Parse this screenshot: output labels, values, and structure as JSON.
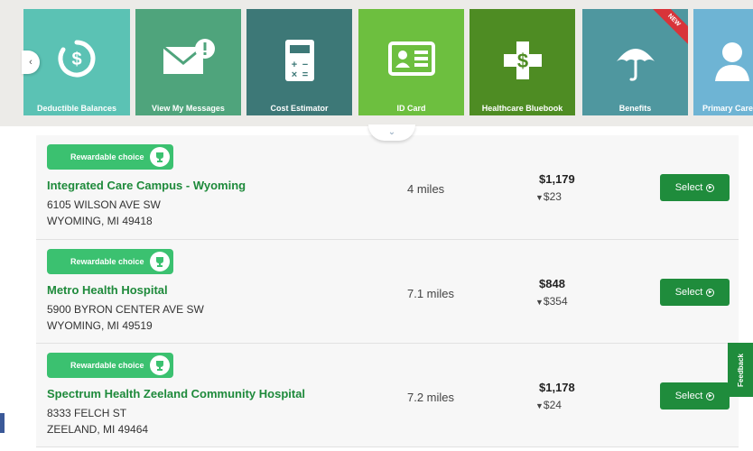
{
  "tiles": [
    {
      "label": "Deductible Balances",
      "color": "#5bc2b4",
      "icon": "dollar-circle-icon"
    },
    {
      "label": "View My Messages",
      "color": "#4fa47c",
      "icon": "envelope-alert-icon"
    },
    {
      "label": "Cost Estimator",
      "color": "#3d7877",
      "icon": "calculator-icon"
    },
    {
      "label": "ID Card",
      "color": "#6dbf3f",
      "icon": "id-card-icon"
    },
    {
      "label": "Healthcare Bluebook",
      "color": "#4e8c23",
      "icon": "medical-dollar-icon"
    },
    {
      "label": "Benefits",
      "color": "#4f979f",
      "icon": "umbrella-icon",
      "badge": "NEW"
    },
    {
      "label": "Primary Care",
      "color": "#6eb4d4",
      "icon": "person-icon"
    }
  ],
  "expand_symbol": "⌄",
  "nav_prev_symbol": "‹",
  "results": [
    {
      "badge": "Rewardable choice",
      "name": "Integrated Care Campus - Wyoming",
      "address1": "6105 WILSON AVE SW",
      "address2": "WYOMING, MI 49418",
      "distance": "4 miles",
      "price": "$1,179",
      "savings": "$23",
      "select_label": "Select"
    },
    {
      "badge": "Rewardable choice",
      "name": "Metro Health Hospital",
      "address1": "5900 BYRON CENTER AVE SW",
      "address2": "WYOMING, MI 49519",
      "distance": "7.1 miles",
      "price": "$848",
      "savings": "$354",
      "select_label": "Select"
    },
    {
      "badge": "Rewardable choice",
      "name": "Spectrum Health Zeeland Community Hospital",
      "address1": "8333 FELCH ST",
      "address2": "ZEELAND, MI 49464",
      "distance": "7.2 miles",
      "price": "$1,178",
      "savings": "$24",
      "select_label": "Select"
    }
  ],
  "feedback_label": "Feedback",
  "colors": {
    "accent_green": "#1f8c3c",
    "badge_green": "#3bc170",
    "name_green": "#1e8a3b"
  }
}
